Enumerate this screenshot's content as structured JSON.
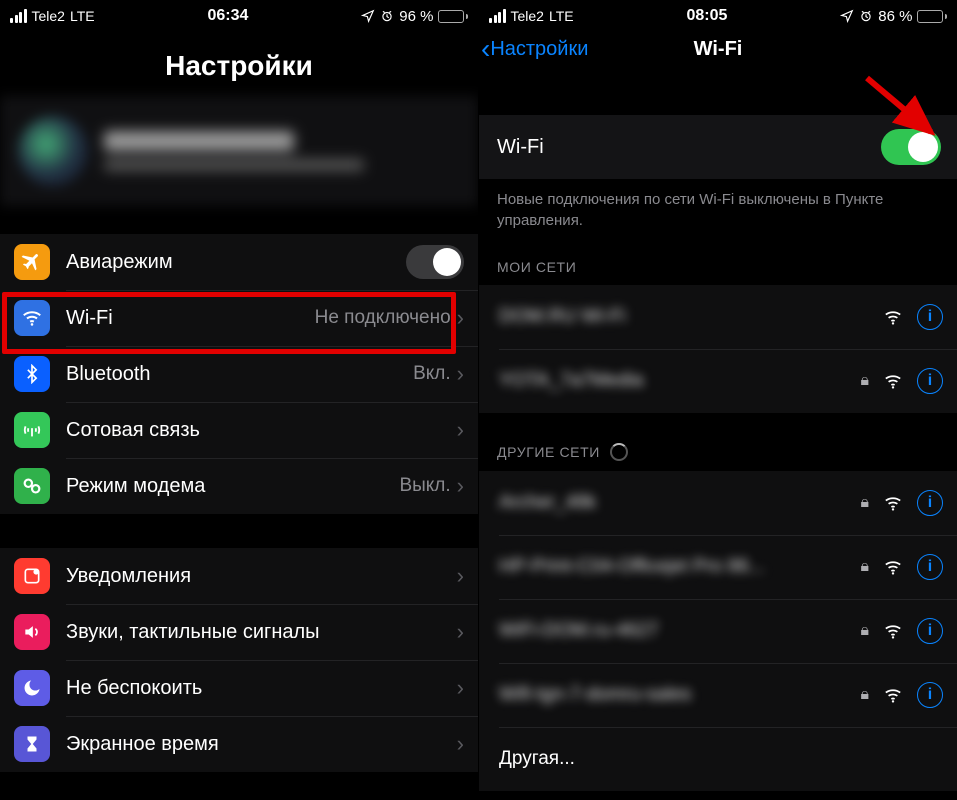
{
  "left": {
    "statusbar": {
      "carrier": "Tele2",
      "net": "LTE",
      "time": "06:34",
      "battery_pct": "96 %",
      "battery_fill": 96
    },
    "title": "Настройки",
    "rows": {
      "airplane": "Авиарежим",
      "wifi_label": "Wi-Fi",
      "wifi_value": "Не подключено",
      "bluetooth_label": "Bluetooth",
      "bluetooth_value": "Вкл.",
      "cellular": "Сотовая связь",
      "hotspot_label": "Режим модема",
      "hotspot_value": "Выкл.",
      "notifications": "Уведомления",
      "sounds": "Звуки, тактильные сигналы",
      "dnd": "Не беспокоить",
      "screentime": "Экранное время"
    }
  },
  "right": {
    "statusbar": {
      "carrier": "Tele2",
      "net": "LTE",
      "time": "08:05",
      "battery_pct": "86 %",
      "battery_fill": 86
    },
    "back_label": "Настройки",
    "title": "Wi-Fi",
    "wifi_switch_label": "Wi-Fi",
    "note": "Новые подключения по сети Wi-Fi выключены в Пункте управления.",
    "my_networks_header": "МОИ СЕТИ",
    "other_networks_header": "ДРУГИЕ СЕТИ",
    "other_label": "Другая...",
    "networks": {
      "mine": [
        {
          "name": "DOM.RU Wi-Fi",
          "locked": false
        },
        {
          "name": "YOTA_7a7Media",
          "locked": true
        }
      ],
      "others": [
        {
          "name": "Archer_48k",
          "locked": true
        },
        {
          "name": "HP-Print-C04-Officejet Pro 86...",
          "locked": true
        },
        {
          "name": "WiFi-DOM.ru-4627",
          "locked": true
        },
        {
          "name": "Wifi-tgn-7-domru-sales",
          "locked": true
        }
      ]
    }
  }
}
